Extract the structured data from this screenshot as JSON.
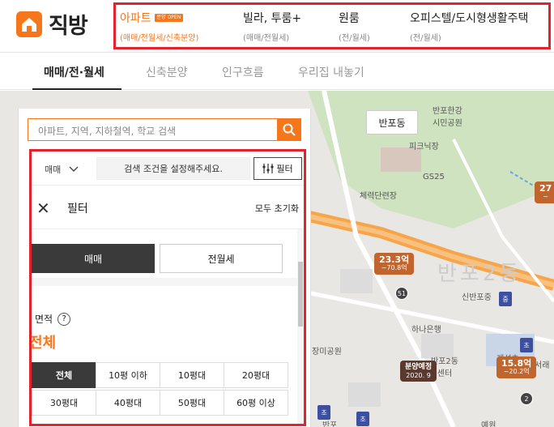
{
  "brand": {
    "name": "직방"
  },
  "nav": [
    {
      "label": "아파트",
      "badge": "분양 OPEN",
      "sub": "(매매/전월세/신축분양)",
      "active": true
    },
    {
      "label": "빌라, 투룸+",
      "sub": "(매매/전월세)",
      "active": false
    },
    {
      "label": "원룸",
      "sub": "(전/월세)",
      "active": false
    },
    {
      "label": "오피스텔/도시형생활주택",
      "sub": "(전/월세)",
      "active": false
    }
  ],
  "tabs": [
    {
      "label": "매매/전·월세",
      "active": true
    },
    {
      "label": "신축분양",
      "active": false
    },
    {
      "label": "인구흐름",
      "active": false
    },
    {
      "label": "우리집 내놓기",
      "active": false
    }
  ],
  "search": {
    "placeholder": "아파트, 지역, 지하철역, 학교 검색"
  },
  "filter_bar": {
    "deal_type": "매매",
    "condition_hint": "검색 조건을 설정해주세요.",
    "filter_button": "필터"
  },
  "filter_panel": {
    "title": "필터",
    "reset": "모두 초기화",
    "toggle": [
      {
        "label": "매매",
        "on": true
      },
      {
        "label": "전월세",
        "on": false
      }
    ],
    "area_label": "면적",
    "area_help": "?",
    "area_value": "전체",
    "area_options": [
      "전체",
      "10평 이하",
      "10평대",
      "20평대",
      "30평대",
      "40평대",
      "50평대",
      "60평 이상"
    ]
  },
  "map": {
    "location_chip": "반포동",
    "labels": {
      "hangang_park": "반포한강\n시민공원",
      "picnic": "피크닉장",
      "gs25": "GS25",
      "stadium": "체력단련장",
      "sinban": "신반포중",
      "hana": "하나은행",
      "jangmi": "장미공원",
      "banpo2": "반포2동\n센터",
      "yewon": "예원",
      "banpo_school": "반포",
      "gyeseong": "계성초",
      "seorae": "서래"
    },
    "district": "반포2동",
    "markers": [
      {
        "v1": "23.3억",
        "v2": "~70.8억"
      },
      {
        "v1": "15.8억",
        "v2": "~20.2억"
      },
      {
        "v1": "27",
        "v2": "~"
      }
    ],
    "presale": {
      "v1": "분양예정",
      "v2": "2020. 9"
    },
    "counts": [
      "51",
      "2"
    ],
    "flags": [
      "중",
      "초",
      "초",
      "초"
    ]
  },
  "colors": {
    "accent": "#f5761b",
    "highlight_border": "#e3232c"
  }
}
